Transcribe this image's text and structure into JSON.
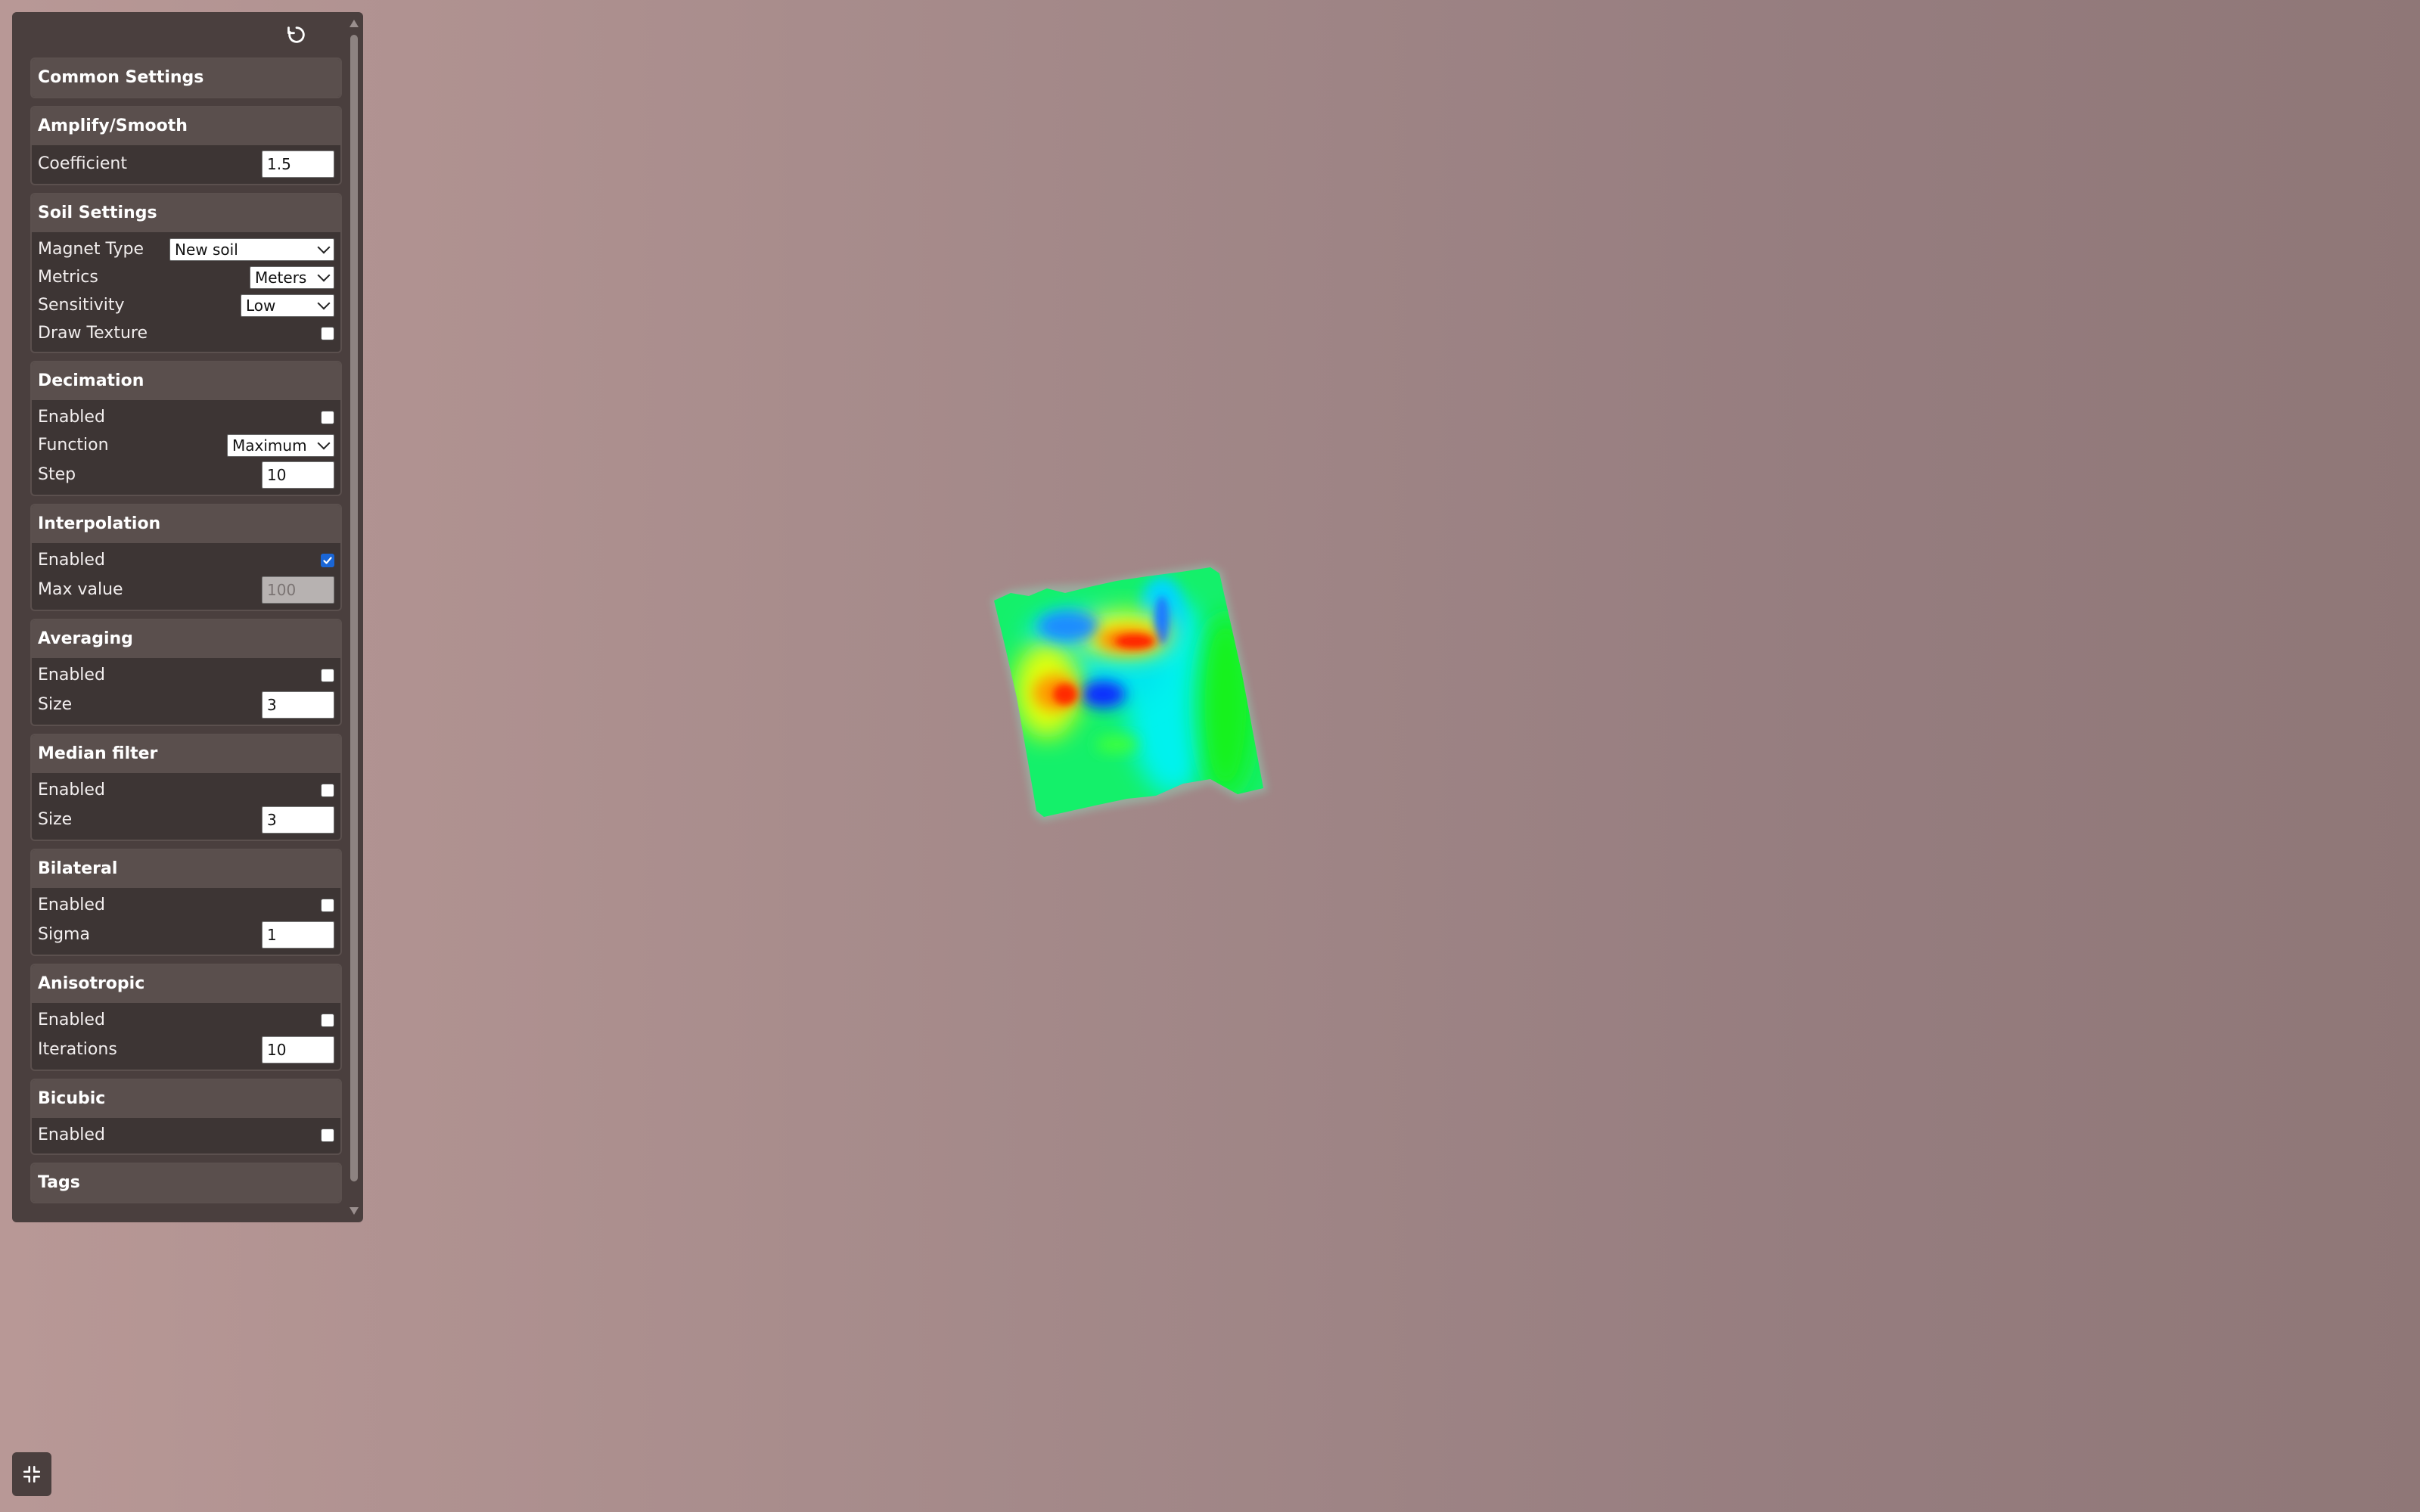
{
  "panel": {
    "reset_icon": "reset-icon",
    "sections": {
      "common": {
        "title": "Common Settings"
      },
      "amplify": {
        "title": "Amplify/Smooth",
        "coefficient_label": "Coefficient",
        "coefficient_value": "1.5"
      },
      "soil": {
        "title": "Soil Settings",
        "magnet_type_label": "Magnet Type",
        "magnet_type_value": "New soil",
        "metrics_label": "Metrics",
        "metrics_value": "Meters",
        "sensitivity_label": "Sensitivity",
        "sensitivity_value": "Low",
        "draw_texture_label": "Draw Texture",
        "draw_texture_checked": false
      },
      "decimation": {
        "title": "Decimation",
        "enabled_label": "Enabled",
        "enabled_checked": false,
        "function_label": "Function",
        "function_value": "Maximum",
        "step_label": "Step",
        "step_value": "10"
      },
      "interpolation": {
        "title": "Interpolation",
        "enabled_label": "Enabled",
        "enabled_checked": true,
        "max_value_label": "Max value",
        "max_value_value": "100"
      },
      "averaging": {
        "title": "Averaging",
        "enabled_label": "Enabled",
        "enabled_checked": false,
        "size_label": "Size",
        "size_value": "3"
      },
      "median": {
        "title": "Median filter",
        "enabled_label": "Enabled",
        "enabled_checked": false,
        "size_label": "Size",
        "size_value": "3"
      },
      "bilateral": {
        "title": "Bilateral",
        "enabled_label": "Enabled",
        "enabled_checked": false,
        "sigma_label": "Sigma",
        "sigma_value": "1"
      },
      "anisotropic": {
        "title": "Anisotropic",
        "enabled_label": "Enabled",
        "enabled_checked": false,
        "iterations_label": "Iterations",
        "iterations_value": "10"
      },
      "bicubic": {
        "title": "Bicubic",
        "enabled_label": "Enabled",
        "enabled_checked": false
      },
      "tags": {
        "title": "Tags"
      }
    }
  },
  "colors": {
    "panel_bg": "#4a3f3e",
    "section_header_bg": "#5a4f4d",
    "checkbox_accent": "#1a66d6",
    "background_left": "#b89896",
    "background_right": "#8f7777"
  },
  "surface_palette": [
    "#0000ff",
    "#00ffff",
    "#00ff00",
    "#ffff00",
    "#ff0000"
  ],
  "collapse_button_icon": "compress-icon"
}
